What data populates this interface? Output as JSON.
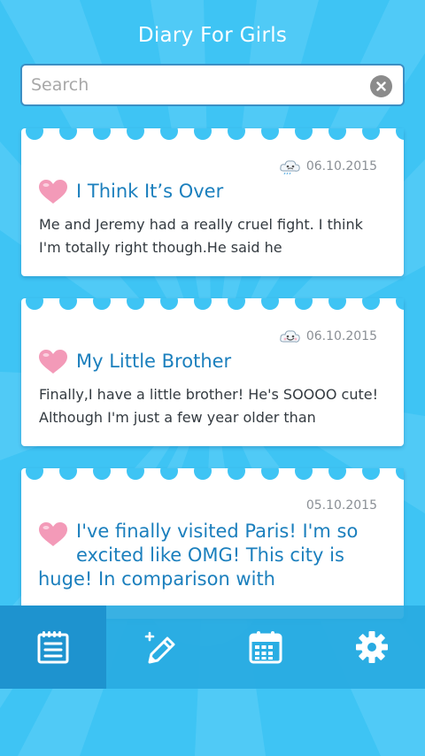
{
  "header": {
    "title": "Diary For Girls"
  },
  "search": {
    "placeholder": "Search",
    "value": ""
  },
  "entries": [
    {
      "date": "06.10.2015",
      "mood_icon": "cloud-face-icon",
      "title": "I Think It’s Over",
      "preview": "Me and Jeremy had a really cruel fight. I think I'm totally right though.He said he"
    },
    {
      "date": "06.10.2015",
      "mood_icon": "smiley-cloud-icon",
      "title": "My Little Brother",
      "preview": "Finally,I have a little brother! He's SOOOO cute! Although I'm just a few year older than"
    },
    {
      "date": "05.10.2015",
      "title": "I've finally visited Paris! I'm so excited like OMG! This city is huge! In comparison with"
    }
  ],
  "nav": [
    {
      "icon": "notebook-icon",
      "active": true
    },
    {
      "icon": "new-entry-pencil-icon",
      "active": false
    },
    {
      "icon": "calendar-icon",
      "active": false
    },
    {
      "icon": "settings-gear-icon",
      "active": false
    }
  ],
  "colors": {
    "background": "#3ec4f4",
    "ray": "#62d2fa",
    "title_text": "#1b7fbd",
    "heart": "#f39ab8",
    "nav_bar": "#28aae1",
    "nav_active": "#1e93cf"
  }
}
